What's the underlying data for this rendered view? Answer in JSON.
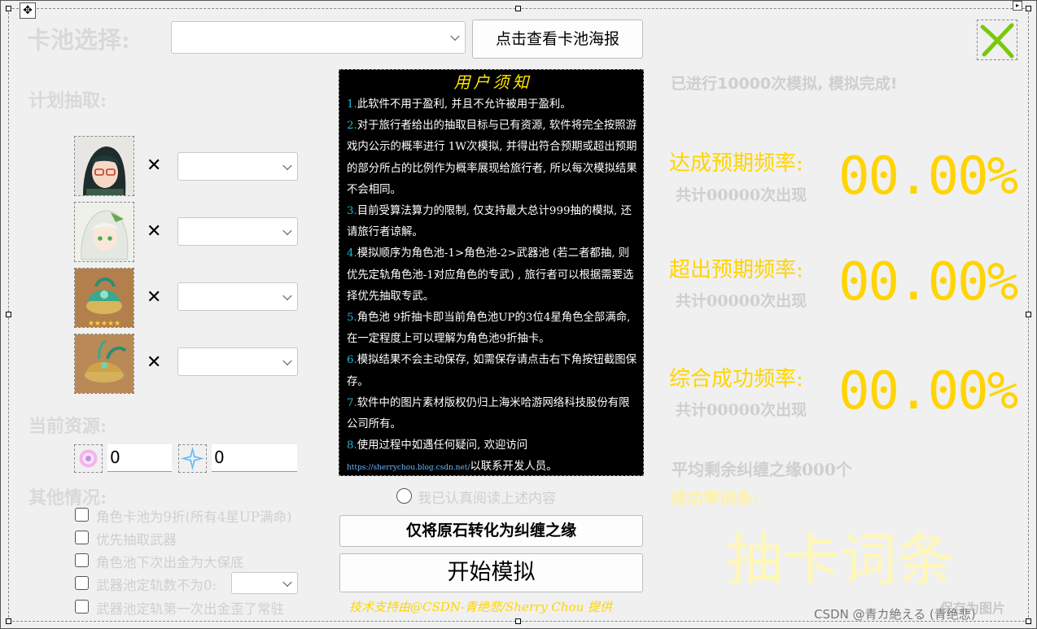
{
  "pool_select": {
    "label": "卡池选择:",
    "value": ""
  },
  "poster_button": "点击查看卡池海报",
  "plan_label": "计划抽取:",
  "plan_items": [
    {
      "name": "xiao-avatar",
      "times": "✕",
      "value": ""
    },
    {
      "name": "nahida-avatar",
      "times": "✕",
      "value": ""
    },
    {
      "name": "weapon-lamp-avatar",
      "times": "✕",
      "value": ""
    },
    {
      "name": "weapon-lamp2-avatar",
      "times": "✕",
      "value": ""
    }
  ],
  "resources": {
    "label": "当前资源:",
    "fate_value": "0",
    "primogem_value": "0"
  },
  "other": {
    "label": "其他情况:",
    "options": [
      "角色卡池为9折(所有4星UP满命)",
      "优先抽取武器",
      "角色池下次出金为大保底",
      "武器池定轨数不为0:",
      "武器池定轨第一次出金歪了常驻"
    ]
  },
  "notice": {
    "title": "用户须知",
    "items": [
      {
        "n": "1.",
        "text": "此软件不用于盈利, 并且不允许被用于盈利。"
      },
      {
        "n": "2.",
        "text": "对于旅行者给出的抽取目标与已有资源, 软件将完全按照游戏内公示的概率进行 1W次模拟, 并得出符合预期或超出预期的部分所占的比例作为概率展现给旅行者, 所以每次模拟结果不会相同。"
      },
      {
        "n": "3.",
        "text": "目前受算法算力的限制, 仅支持最大总计999抽的模拟, 还请旅行者谅解。"
      },
      {
        "n": "4.",
        "text": "模拟顺序为角色池-1>角色池-2>武器池 (若二者都抽, 则优先定轨角色池-1对应角色的专武) , 旅行者可以根据需要选择优先抽取专武。"
      },
      {
        "n": "5.",
        "text": "角色池 9折抽卡即当前角色池UP的3位4星角色全部满命, 在一定程度上可以理解为角色池9折抽卡。"
      },
      {
        "n": "6.",
        "text": "模拟结果不会主动保存, 如需保存请点击右下角按钮截图保存。"
      },
      {
        "n": "7.",
        "text": "软件中的图片素材版权仍归上海米哈游网络科技股份有限公司所有。"
      },
      {
        "n": "8.",
        "text": "使用过程中如遇任何疑问, 欢迎访问"
      }
    ],
    "url": "https://sherrychou.blog.csdn.net/",
    "url_suffix": "以联系开发人员。"
  },
  "read_confirm": "我已认真阅读上述内容",
  "convert_button": "仅将原石转化为纠缠之缘",
  "start_button": "开始模拟",
  "credit": "技术支持由@CSDN-青绝悲/Sherry Chou 提供",
  "status": "已进行10000次模拟, 模拟完成!",
  "results": [
    {
      "label": "达成预期频率:",
      "count": "共计00000次出现",
      "value": "00.00%"
    },
    {
      "label": "超出预期频率:",
      "count": "共计00000次出现",
      "value": "00.00%"
    },
    {
      "label": "综合成功频率:",
      "count": "共计00000次出现",
      "value": "00.00%"
    }
  ],
  "remaining": "平均剩余纠缠之缘000个",
  "success_label": "成功率词条:",
  "success_term": "抽卡词条",
  "save_image": "保存为图片",
  "watermark": "CSDN @青カ絶える (青绝悲)",
  "colors": {
    "accent": "#ffd400",
    "faint": "#d9d9d9",
    "notice_bg": "#000000",
    "close_green": "#7ac70c"
  }
}
